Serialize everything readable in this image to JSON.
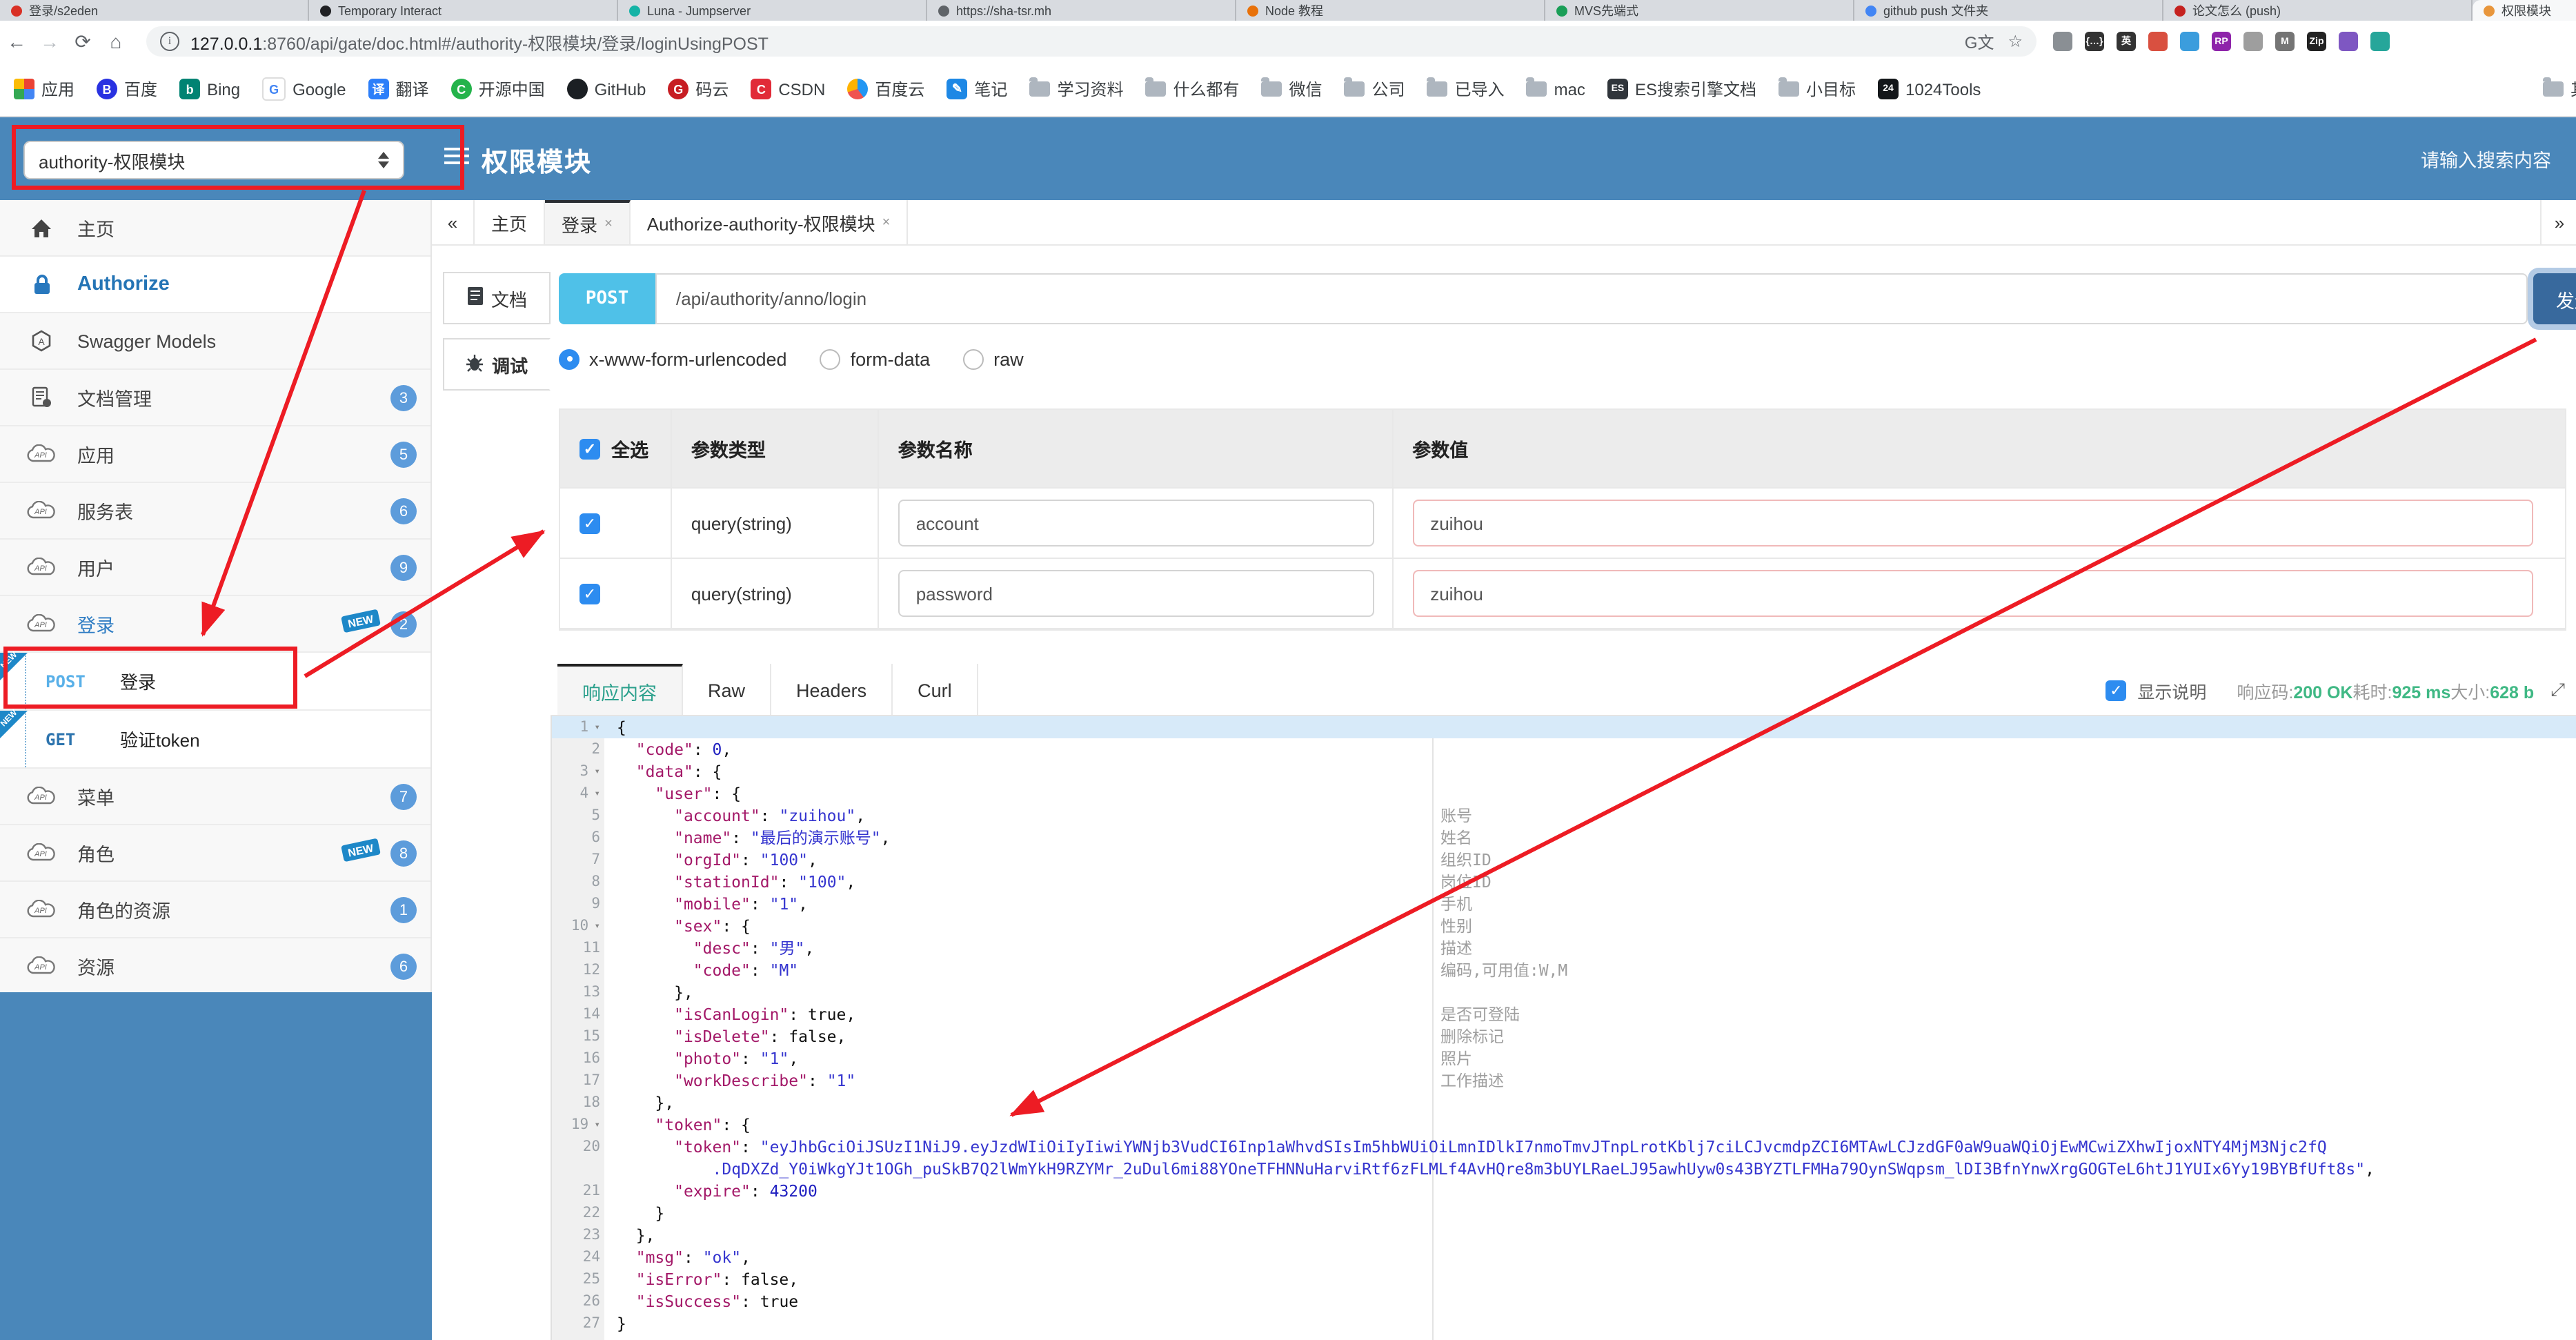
{
  "browser": {
    "tabs": [
      {
        "label": "登录/s2eden",
        "color": "#d93025"
      },
      {
        "label": "Temporary Interact",
        "color": "#202124"
      },
      {
        "label": "Luna - Jumpserver",
        "color": "#14b3a6"
      },
      {
        "label": "https://sha-tsr.mh",
        "color": "#5f6368"
      },
      {
        "label": "Node 教程",
        "color": "#e8710a"
      },
      {
        "label": "MVS先端式",
        "color": "#1a9e57"
      },
      {
        "label": "github push 文件夹",
        "color": "#4285f4"
      },
      {
        "label": "论文怎么 (push)",
        "color": "#c5221f"
      },
      {
        "label": "权限模块",
        "color": "#e8963c",
        "active": true
      }
    ],
    "nav": {
      "url_host": "127.0.0.1",
      "url_rest": ":8760/api/gate/doc.html#/authority-权限模块/登录/loginUsingPOST"
    },
    "extensions": [
      "#8a8f94",
      "#333333",
      "#333333",
      "#d95040",
      "#3b9ddd",
      "#8e24aa",
      "#9e9e9e",
      "#757575",
      "#222222",
      "#7e57c2",
      "#26a69a"
    ],
    "bookmarks": [
      {
        "icon": "apps-grid-icon",
        "label": "应用"
      },
      {
        "icon": "baidu-icon",
        "label": "百度"
      },
      {
        "icon": "bing-icon",
        "label": "Bing"
      },
      {
        "icon": "google-icon",
        "label": "Google"
      },
      {
        "icon": "translate-icon",
        "label": "翻译"
      },
      {
        "icon": "oschina-icon",
        "label": "开源中国"
      },
      {
        "icon": "github-icon",
        "label": "GitHub"
      },
      {
        "icon": "gitee-icon",
        "label": "码云"
      },
      {
        "icon": "csdn-icon",
        "label": "CSDN"
      },
      {
        "icon": "baidu-cloud-icon",
        "label": "百度云"
      },
      {
        "icon": "note-icon",
        "label": "笔记"
      },
      {
        "icon": "folder-icon",
        "label": "学习资料"
      },
      {
        "icon": "folder-icon",
        "label": "什么都有"
      },
      {
        "icon": "folder-icon",
        "label": "微信"
      },
      {
        "icon": "folder-icon",
        "label": "公司"
      },
      {
        "icon": "folder-icon",
        "label": "已导入"
      },
      {
        "icon": "folder-icon",
        "label": "mac"
      },
      {
        "icon": "es-doc-icon",
        "label": "ES搜索引擎文档"
      },
      {
        "icon": "folder-icon",
        "label": "小目标"
      },
      {
        "icon": "tools1024-icon",
        "label": "1024Tools"
      }
    ],
    "other_bookmarks": "其他书签"
  },
  "header": {
    "module_select": "authority-权限模块",
    "title": "权限模块",
    "search_placeholder": "请输入搜索内容"
  },
  "sidebar": {
    "items": [
      {
        "icon": "home-icon",
        "label": "主页"
      },
      {
        "icon": "lock-icon",
        "label": "Authorize",
        "style": "authorize"
      },
      {
        "icon": "swagger-icon",
        "label": "Swagger Models"
      },
      {
        "icon": "doc-manage-icon",
        "label": "文档管理",
        "badge": "3"
      },
      {
        "icon": "api-cloud-icon",
        "label": "应用",
        "badge": "5"
      },
      {
        "icon": "api-cloud-icon",
        "label": "服务表",
        "badge": "6"
      },
      {
        "icon": "api-cloud-icon",
        "label": "用户",
        "badge": "9"
      },
      {
        "icon": "api-cloud-icon",
        "label": "登录",
        "badge": "2",
        "new_tag": true,
        "active": true
      },
      {
        "op": "POST",
        "label": "登录",
        "new_ribbon": true,
        "red_box": true
      },
      {
        "op": "GET",
        "label": "验证token",
        "new_ribbon": true
      },
      {
        "icon": "api-cloud-icon",
        "label": "菜单",
        "badge": "7"
      },
      {
        "icon": "api-cloud-icon",
        "label": "角色",
        "badge": "8",
        "new_tag": true
      },
      {
        "icon": "api-cloud-icon",
        "label": "角色的资源",
        "badge": "1"
      },
      {
        "icon": "api-cloud-icon",
        "label": "资源",
        "badge": "6"
      }
    ]
  },
  "tabsbar": {
    "collapse": "«",
    "expand": "»",
    "tabs": [
      {
        "label": "主页"
      },
      {
        "label": "登录",
        "closable": true,
        "active": true
      },
      {
        "label": "Authorize-authority-权限模块",
        "closable": true
      }
    ]
  },
  "doc_tabs": [
    {
      "icon": "doc-icon",
      "label": "文档"
    },
    {
      "icon": "debug-icon",
      "label": "调试",
      "active": true
    }
  ],
  "request": {
    "method": "POST",
    "url": "/api/authority/anno/login",
    "send_label": "发送",
    "content_types": [
      {
        "label": "x-www-form-urlencoded",
        "selected": true
      },
      {
        "label": "form-data"
      },
      {
        "label": "raw"
      }
    ]
  },
  "params_table": {
    "headers": [
      "全选",
      "参数类型",
      "参数名称",
      "参数值"
    ],
    "rows": [
      {
        "checked": true,
        "type": "query(string)",
        "name": "account",
        "value": "zuihou"
      },
      {
        "checked": true,
        "type": "query(string)",
        "name": "password",
        "value": "zuihou"
      }
    ]
  },
  "response": {
    "tabs": [
      "响应内容",
      "Raw",
      "Headers",
      "Curl"
    ],
    "active_tab": "响应内容",
    "desc_label": "显示说明",
    "desc_checked": true,
    "meta": [
      {
        "label": "响应码:",
        "value": "200 OK"
      },
      {
        "label": "耗时:",
        "value": "925 ms"
      },
      {
        "label": "大小:",
        "value": "628 b"
      }
    ]
  },
  "code": {
    "token_full": "eyJhbGciOiJSUzI1NiJ9.eyJzdWIiOiIyIiwiYWNjb3VudCI6Inp1aWhvdSIsIm5hbWUiOiLmnIDlkI7nmoTmvJTnpLrotKblj7ciLCJvcmdpZCI6MTAwLCJzdGF0aW9uaWQiOjEwMCwiZXhwIjoxNTY4MjM3Njc2fQ.DqDXZd_Y0iWkgYJt1OGh_puSkB7Q2lWmYkH9RZYMr_2uDul6mi88YOneTFHNNuHarviRtf6zFLMLf4AvHQre8m3bUYLRaeLJ95awhUyw0s43BYZTLFMHa79OynSWqpsm_lDI3BfnYnwXrgGOGTeL6htJ1YUIx6Yy19BYBfUft8s",
    "lines": [
      {
        "n": 1,
        "f": 1,
        "p": [
          [
            "t",
            "{"
          ]
        ]
      },
      {
        "n": 2,
        "p": [
          [
            "t",
            "  "
          ],
          [
            "k",
            "\"code\""
          ],
          [
            "t",
            ": "
          ],
          [
            "n",
            "0"
          ],
          [
            "t",
            ","
          ]
        ]
      },
      {
        "n": 3,
        "f": 1,
        "p": [
          [
            "t",
            "  "
          ],
          [
            "k",
            "\"data\""
          ],
          [
            "t",
            ": {"
          ]
        ]
      },
      {
        "n": 4,
        "f": 1,
        "p": [
          [
            "t",
            "    "
          ],
          [
            "k",
            "\"user\""
          ],
          [
            "t",
            ": {"
          ]
        ]
      },
      {
        "n": 5,
        "c": "账号",
        "p": [
          [
            "t",
            "      "
          ],
          [
            "k",
            "\"account\""
          ],
          [
            "t",
            ": "
          ],
          [
            "s",
            "\"zuihou\""
          ],
          [
            "t",
            ","
          ]
        ]
      },
      {
        "n": 6,
        "c": "姓名",
        "p": [
          [
            "t",
            "      "
          ],
          [
            "k",
            "\"name\""
          ],
          [
            "t",
            ": "
          ],
          [
            "s",
            "\"最后的演示账号\""
          ],
          [
            "t",
            ","
          ]
        ]
      },
      {
        "n": 7,
        "c": "组织ID",
        "p": [
          [
            "t",
            "      "
          ],
          [
            "k",
            "\"orgId\""
          ],
          [
            "t",
            ": "
          ],
          [
            "s",
            "\"100\""
          ],
          [
            "t",
            ","
          ]
        ]
      },
      {
        "n": 8,
        "c": "岗位ID",
        "p": [
          [
            "t",
            "      "
          ],
          [
            "k",
            "\"stationId\""
          ],
          [
            "t",
            ": "
          ],
          [
            "s",
            "\"100\""
          ],
          [
            "t",
            ","
          ]
        ]
      },
      {
        "n": 9,
        "c": "手机",
        "p": [
          [
            "t",
            "      "
          ],
          [
            "k",
            "\"mobile\""
          ],
          [
            "t",
            ": "
          ],
          [
            "s",
            "\"1\""
          ],
          [
            "t",
            ","
          ]
        ]
      },
      {
        "n": 10,
        "f": 1,
        "c": "性别",
        "p": [
          [
            "t",
            "      "
          ],
          [
            "k",
            "\"sex\""
          ],
          [
            "t",
            ": {"
          ]
        ]
      },
      {
        "n": 11,
        "c": "描述",
        "p": [
          [
            "t",
            "        "
          ],
          [
            "k",
            "\"desc\""
          ],
          [
            "t",
            ": "
          ],
          [
            "s",
            "\"男\""
          ],
          [
            "t",
            ","
          ]
        ]
      },
      {
        "n": 12,
        "c": "编码,可用值:W,M",
        "p": [
          [
            "t",
            "        "
          ],
          [
            "k",
            "\"code\""
          ],
          [
            "t",
            ": "
          ],
          [
            "s",
            "\"M\""
          ]
        ]
      },
      {
        "n": 13,
        "p": [
          [
            "t",
            "      },"
          ]
        ]
      },
      {
        "n": 14,
        "c": "是否可登陆",
        "p": [
          [
            "t",
            "      "
          ],
          [
            "k",
            "\"isCanLogin\""
          ],
          [
            "t",
            ": true,"
          ]
        ]
      },
      {
        "n": 15,
        "c": "删除标记",
        "p": [
          [
            "t",
            "      "
          ],
          [
            "k",
            "\"isDelete\""
          ],
          [
            "t",
            ": false,"
          ]
        ]
      },
      {
        "n": 16,
        "c": "照片",
        "p": [
          [
            "t",
            "      "
          ],
          [
            "k",
            "\"photo\""
          ],
          [
            "t",
            ": "
          ],
          [
            "s",
            "\"1\""
          ],
          [
            "t",
            ","
          ]
        ]
      },
      {
        "n": 17,
        "c": "工作描述",
        "p": [
          [
            "t",
            "      "
          ],
          [
            "k",
            "\"workDescribe\""
          ],
          [
            "t",
            ": "
          ],
          [
            "s",
            "\"1\""
          ]
        ]
      },
      {
        "n": 18,
        "p": [
          [
            "t",
            "    },"
          ]
        ]
      },
      {
        "n": 19,
        "f": 1,
        "p": [
          [
            "t",
            "    "
          ],
          [
            "k",
            "\"token\""
          ],
          [
            "t",
            ": {"
          ]
        ]
      },
      {
        "n": 20,
        "p": [
          [
            "t",
            "      "
          ],
          [
            "k",
            "\"token\""
          ],
          [
            "t",
            ": "
          ],
          [
            "s",
            "\"eyJhbGciOiJSUzI1NiJ9.eyJzdWIiOiIyIiwiYWNjb3VudCI6Inp1aWhvdSIsIm5hbWUiOiLmnIDlkI7nmoTmvJTnpLrotKblj7ciLCJvcmdpZCI6MTAwLCJzdGF0aW9uaWQiOjEwMCwiZXhwIjoxNTY4MjM3Njc2fQ"
          ]
        ]
      },
      {
        "cont": 1,
        "p": [
          [
            "t",
            "          "
          ],
          [
            "s",
            ".DqDXZd_Y0iWkgYJt1OGh_puSkB7Q2lWmYkH9RZYMr_2uDul6mi88YOneTFHNNuHarviRtf6zFLMLf4AvHQre8m3bUYLRaeLJ95awhUyw0s43BYZTLFMHa79OynSWqpsm_lDI3BfnYnwXrgGOGTeL6htJ1YUIx6Yy19BYBfUft8s\""
          ],
          [
            "t",
            ","
          ]
        ]
      },
      {
        "n": 21,
        "p": [
          [
            "t",
            "      "
          ],
          [
            "k",
            "\"expire\""
          ],
          [
            "t",
            ": "
          ],
          [
            "n",
            "43200"
          ]
        ]
      },
      {
        "n": 22,
        "p": [
          [
            "t",
            "    }"
          ]
        ]
      },
      {
        "n": 23,
        "p": [
          [
            "t",
            "  },"
          ]
        ]
      },
      {
        "n": 24,
        "p": [
          [
            "t",
            "  "
          ],
          [
            "k",
            "\"msg\""
          ],
          [
            "t",
            ": "
          ],
          [
            "s",
            "\"ok\""
          ],
          [
            "t",
            ","
          ]
        ]
      },
      {
        "n": 25,
        "p": [
          [
            "t",
            "  "
          ],
          [
            "k",
            "\"isError\""
          ],
          [
            "t",
            ": false,"
          ]
        ]
      },
      {
        "n": 26,
        "p": [
          [
            "t",
            "  "
          ],
          [
            "k",
            "\"isSuccess\""
          ],
          [
            "t",
            ": true"
          ]
        ]
      },
      {
        "n": 27,
        "p": [
          [
            "t",
            "}"
          ]
        ]
      }
    ]
  },
  "annotation_color": "#ed1c24"
}
